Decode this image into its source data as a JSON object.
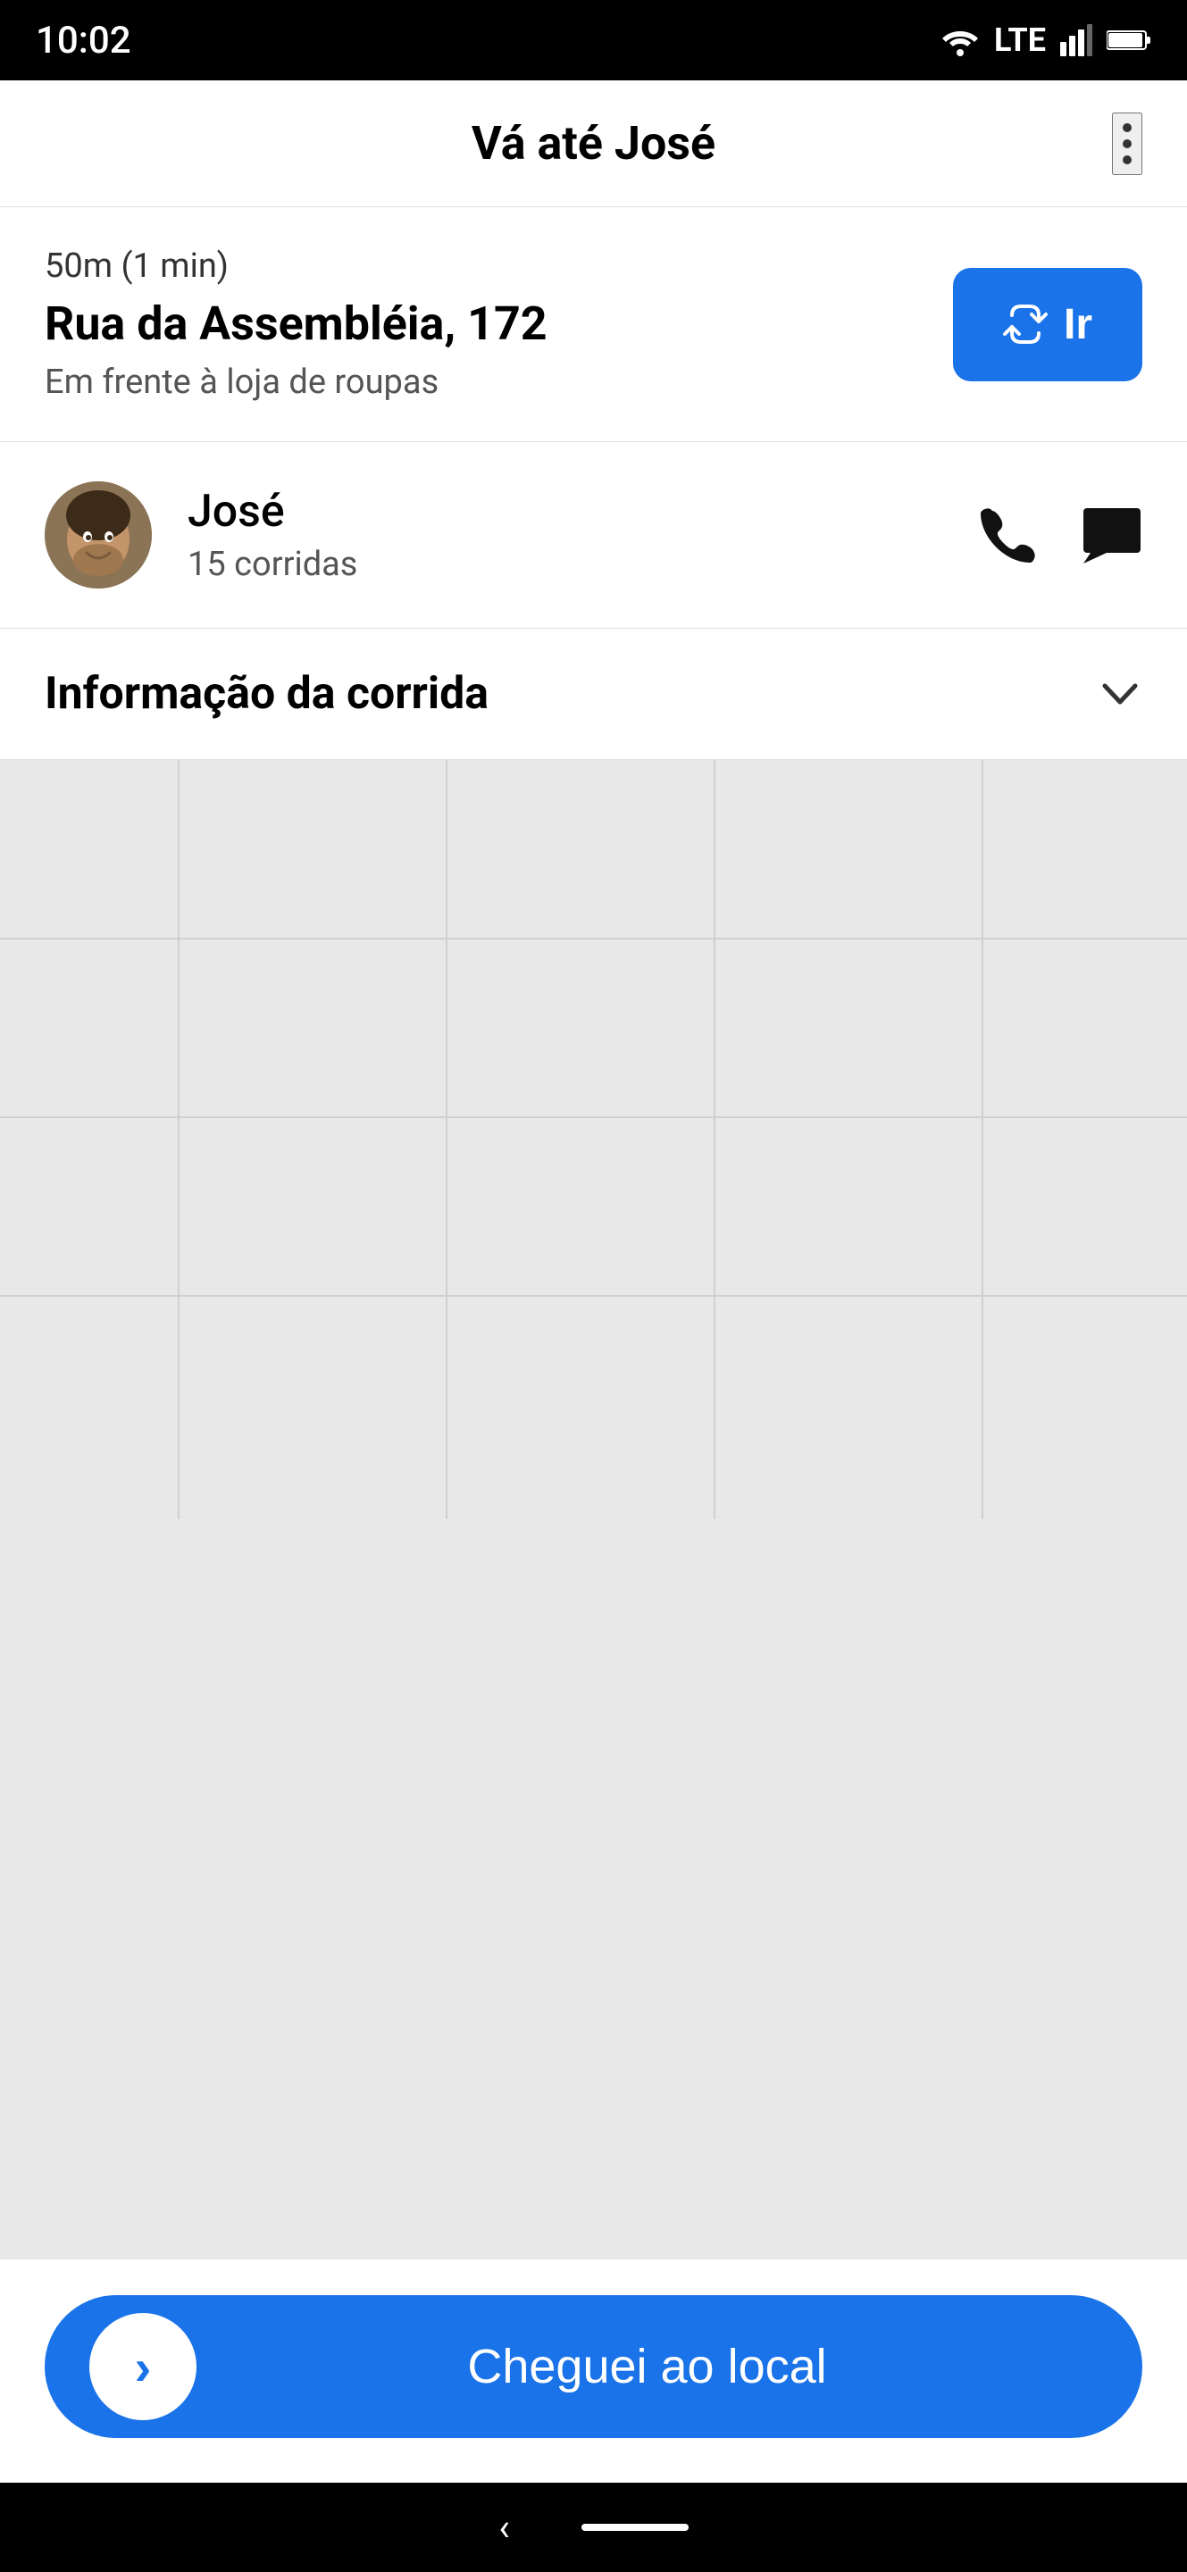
{
  "statusBar": {
    "time": "10:02",
    "lteLabel": "LTE"
  },
  "header": {
    "title": "Vá até José",
    "menuAriaLabel": "menu"
  },
  "addressSection": {
    "distanceTime": "50m (1 min)",
    "addressName": "Rua da Assembléia, 172",
    "addressHint": "Em frente à loja de roupas",
    "goButtonLabel": "Ir"
  },
  "riderSection": {
    "riderName": "José",
    "riderRides": "15 corridas",
    "phoneAriaLabel": "Ligar",
    "messageAriaLabel": "Mensagem"
  },
  "infoSection": {
    "label": "Informação da corrida"
  },
  "bottomAction": {
    "label": "Cheguei ao local"
  }
}
